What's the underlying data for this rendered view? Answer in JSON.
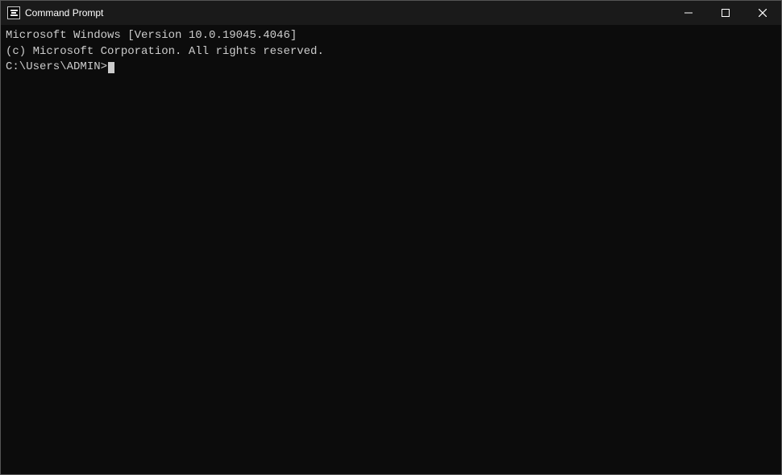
{
  "titleBar": {
    "title": "Command Prompt",
    "iconAlt": "cmd-icon",
    "minimizeLabel": "Minimize",
    "maximizeLabel": "Maximize",
    "closeLabel": "Close"
  },
  "terminal": {
    "line1": "Microsoft Windows [Version 10.0.19045.4046]",
    "line2": "(c) Microsoft Corporation. All rights reserved.",
    "line3": "",
    "prompt": "C:\\Users\\ADMIN>"
  }
}
